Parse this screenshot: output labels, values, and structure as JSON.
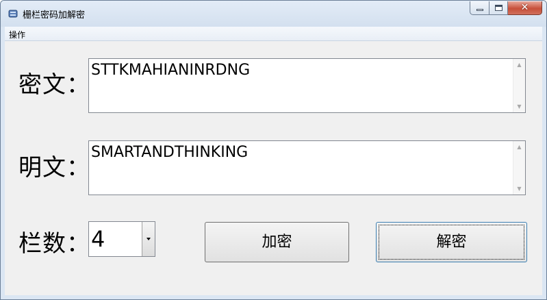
{
  "window": {
    "title": "栅栏密码加解密",
    "close_glyph": "✕"
  },
  "menu": {
    "items": [
      "操作"
    ]
  },
  "form": {
    "ciphertext_label": "密文：",
    "ciphertext_value": "STTKMAHIANINRDNG",
    "plaintext_label": "明文：",
    "plaintext_value": "SMARTANDTHINKING",
    "rails_label": "栏数：",
    "rails_value": "4"
  },
  "buttons": {
    "encrypt_label": "加密",
    "decrypt_label": "解密"
  },
  "scroll": {
    "up_glyph": "▲",
    "down_glyph": "▼"
  },
  "icons": {
    "app": "app-icon",
    "minimize": "minimize-icon",
    "maximize": "maximize-icon",
    "close": "close-icon",
    "dropdown": "chevron-down-icon"
  }
}
